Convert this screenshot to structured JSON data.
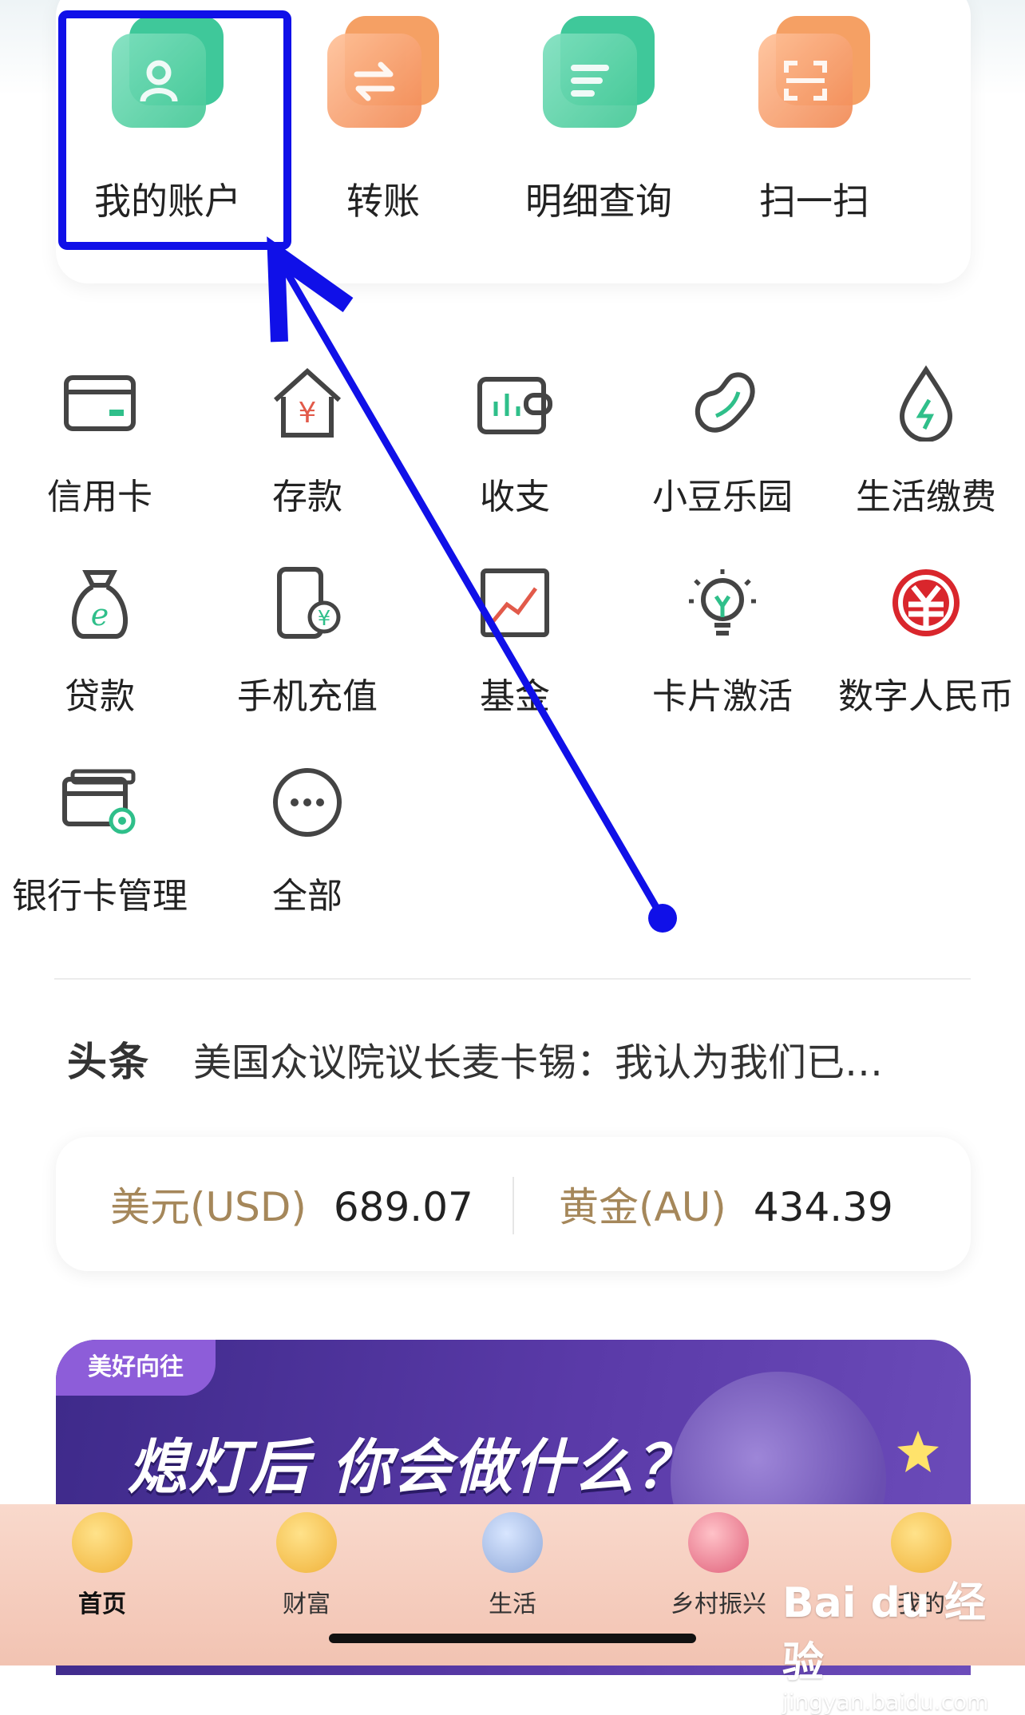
{
  "quick_actions": [
    {
      "label": "我的账户",
      "icon": "user-icon",
      "color": "green"
    },
    {
      "label": "转账",
      "icon": "transfer-icon",
      "color": "orange"
    },
    {
      "label": "明细查询",
      "icon": "list-icon",
      "color": "green"
    },
    {
      "label": "扫一扫",
      "icon": "scan-icon",
      "color": "orange"
    }
  ],
  "services": [
    {
      "label": "信用卡",
      "icon": "credit-card-icon"
    },
    {
      "label": "存款",
      "icon": "deposit-house-icon"
    },
    {
      "label": "收支",
      "icon": "wallet-icon"
    },
    {
      "label": "小豆乐园",
      "icon": "bean-icon"
    },
    {
      "label": "生活缴费",
      "icon": "water-drop-icon"
    },
    {
      "label": "贷款",
      "icon": "money-bag-icon"
    },
    {
      "label": "手机充值",
      "icon": "phone-recharge-icon"
    },
    {
      "label": "基金",
      "icon": "fund-chart-icon"
    },
    {
      "label": "卡片激活",
      "icon": "lightbulb-icon"
    },
    {
      "label": "数字人民币",
      "icon": "digital-rmb-icon"
    },
    {
      "label": "银行卡管理",
      "icon": "card-settings-icon"
    },
    {
      "label": "全部",
      "icon": "more-icon"
    }
  ],
  "headline": {
    "tag": "头条",
    "text": "美国众议院议长麦卡锡：我认为我们已…"
  },
  "rates": [
    {
      "name": "美元(USD)",
      "value": "689.07"
    },
    {
      "name": "黄金(AU)",
      "value": "434.39"
    }
  ],
  "banner": {
    "tag": "美好向往",
    "title": "熄灯后 你会做什么？"
  },
  "tabbar": [
    {
      "label": "首页",
      "active": true
    },
    {
      "label": "财富",
      "active": false
    },
    {
      "label": "生活",
      "active": false
    },
    {
      "label": "乡村振兴",
      "active": false
    },
    {
      "label": "我的",
      "active": false
    }
  ],
  "watermark": {
    "logo": "Bai du 经验",
    "url": "jingyan.baidu.com"
  },
  "colors": {
    "accent_green": "#3fc89a",
    "accent_orange": "#f28a55",
    "annotation_blue": "#1010e8",
    "digital_rmb_red": "#d9262c",
    "rate_gold": "#a5875a"
  }
}
